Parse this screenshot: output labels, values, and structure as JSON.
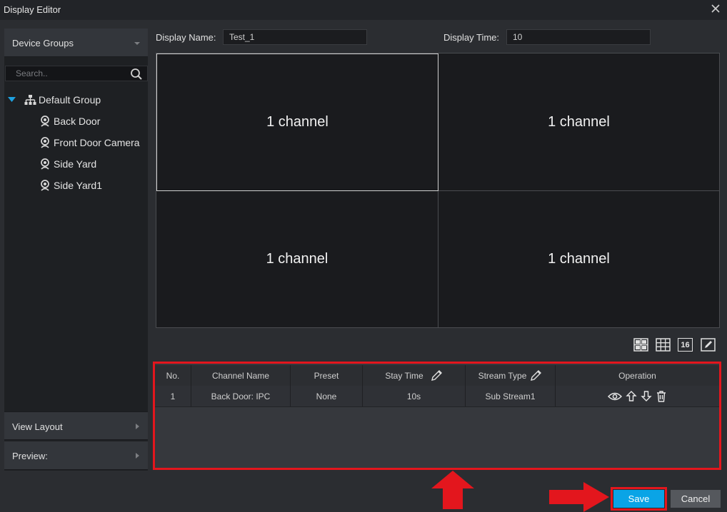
{
  "window": {
    "title": "Display Editor"
  },
  "left_panel": {
    "device_groups_label": "Device Groups",
    "search_placeholder": "Search..",
    "tree": {
      "group_label": "Default Group",
      "devices": [
        "Back Door",
        "Front Door Camera",
        "Side Yard",
        "Side Yard1"
      ]
    },
    "view_layout_label": "View Layout",
    "preview_label": "Preview:"
  },
  "form": {
    "display_name_label": "Display Name:",
    "display_name_value": "Test_1",
    "display_time_label": "Display Time:",
    "display_time_value": "10"
  },
  "grid": {
    "cells": [
      "1 channel",
      "1 channel",
      "1 channel",
      "1 channel"
    ]
  },
  "layout_buttons": {
    "sixteen_label": "16"
  },
  "table": {
    "headers": [
      "No.",
      "Channel Name",
      "Preset",
      "Stay Time",
      "Stream Type",
      "Operation"
    ],
    "rows": [
      {
        "no": "1",
        "channel_name": "Back Door: IPC",
        "preset": "None",
        "stay_time": "10s",
        "stream_type": "Sub Stream1"
      }
    ]
  },
  "footer": {
    "save_label": "Save",
    "cancel_label": "Cancel"
  },
  "colors": {
    "accent": "#0aa4e6",
    "highlight_red": "#e3161d",
    "background": "#2b2d31"
  }
}
